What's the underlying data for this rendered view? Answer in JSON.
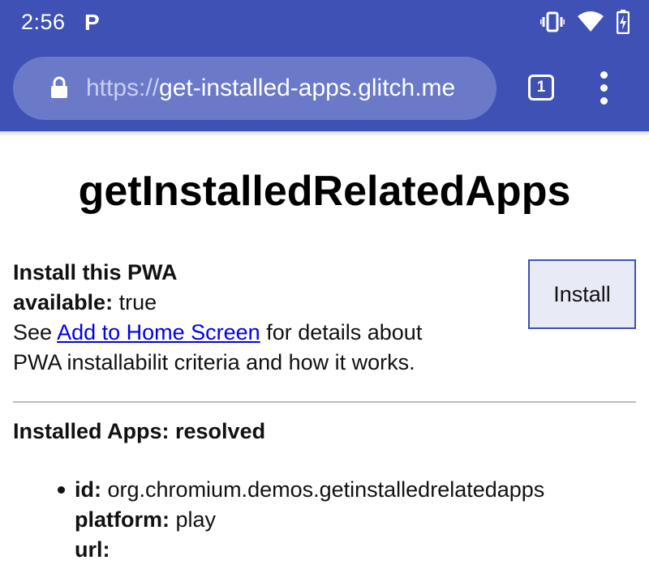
{
  "status_bar": {
    "time": "2:56",
    "notification_app_letter": "P",
    "icons": [
      "vibrate-icon",
      "wifi-icon",
      "battery-charging-icon"
    ]
  },
  "browser": {
    "url_scheme": "https://",
    "url_host": "get-installed-apps.glitch.me",
    "tab_count": "1",
    "colors": {
      "toolbar": "#3f51b5",
      "url_pill": "#6b79c9"
    }
  },
  "page": {
    "title": "getInstalledRelatedApps",
    "install_section": {
      "heading": "Install this PWA",
      "available_label": "available:",
      "available_value": "true",
      "see_text": "See ",
      "link_text": "Add to Home Screen",
      "after_link_text": " for details about",
      "line2": "PWA installabilit criteria and how it works."
    },
    "install_button": "Install",
    "installed_heading": "Installed Apps: resolved",
    "apps": [
      {
        "id_label": "id:",
        "id": "org.chromium.demos.getinstalledrelatedapps",
        "platform_label": "platform:",
        "platform": "play",
        "url_label": "url:",
        "url": ""
      }
    ]
  }
}
